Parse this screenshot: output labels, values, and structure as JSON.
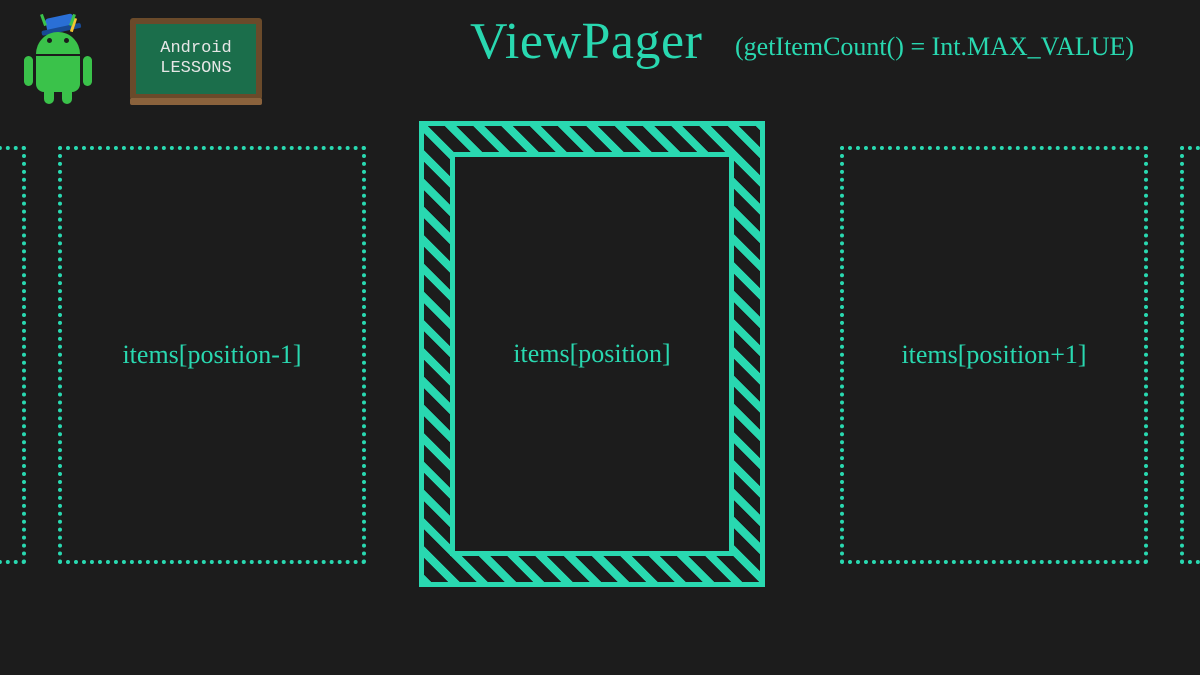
{
  "brand": {
    "chalkboard_line1": "Android",
    "chalkboard_line2": "LESSONS"
  },
  "title": {
    "main": "ViewPager",
    "suffix": "(getItemCount() = Int.MAX_VALUE)"
  },
  "cards": {
    "left": "items[position-1]",
    "center": "items[position]",
    "right": "items[position+1]"
  },
  "colors": {
    "accent": "#29d8b0",
    "android_green": "#3ac24a",
    "background": "#1c1c1c"
  }
}
